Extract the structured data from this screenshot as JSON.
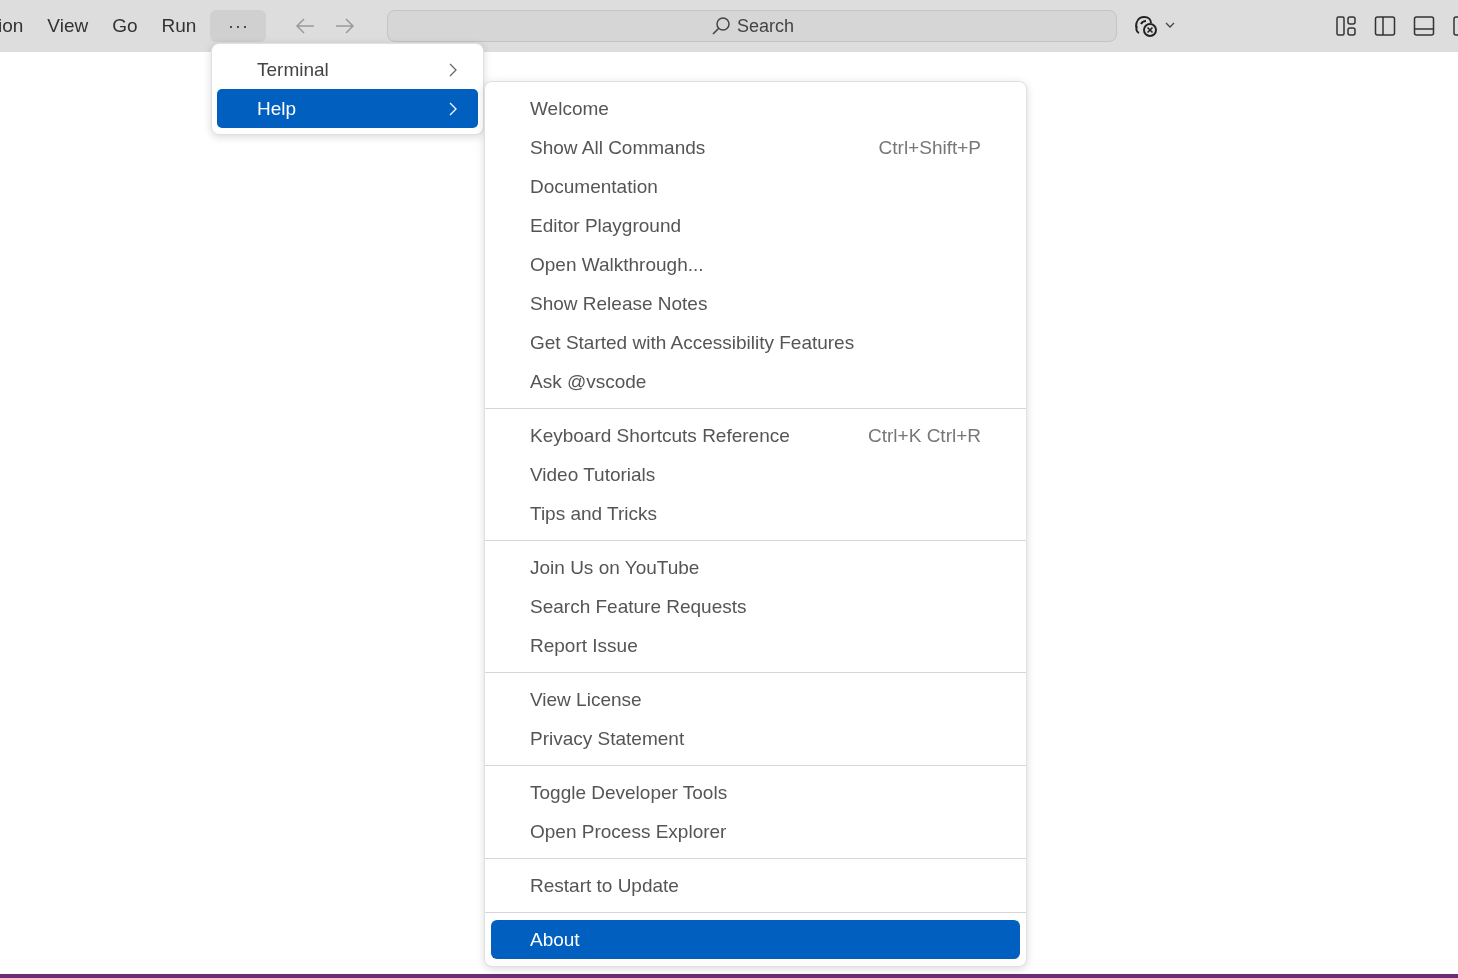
{
  "menubar": {
    "items": [
      {
        "label": "ion"
      },
      {
        "label": "View"
      },
      {
        "label": "Go"
      },
      {
        "label": "Run"
      }
    ],
    "more": {
      "label": "···",
      "selected": true
    }
  },
  "search": {
    "placeholder": "Search"
  },
  "more_menu": {
    "items": [
      {
        "label": "Terminal",
        "selected": false
      },
      {
        "label": "Help",
        "selected": true
      }
    ]
  },
  "help_menu": {
    "groups": [
      {
        "items": [
          {
            "label": "Welcome",
            "selected": false
          },
          {
            "label": "Show All Commands",
            "shortcut": "Ctrl+Shift+P",
            "selected": false
          },
          {
            "label": "Documentation",
            "selected": false
          },
          {
            "label": "Editor Playground",
            "selected": false
          },
          {
            "label": "Open Walkthrough...",
            "selected": false
          },
          {
            "label": "Show Release Notes",
            "selected": false
          },
          {
            "label": "Get Started with Accessibility Features",
            "selected": false
          },
          {
            "label": "Ask @vscode",
            "selected": false
          }
        ]
      },
      {
        "items": [
          {
            "label": "Keyboard Shortcuts Reference",
            "shortcut": "Ctrl+K Ctrl+R",
            "selected": false
          },
          {
            "label": "Video Tutorials",
            "selected": false
          },
          {
            "label": "Tips and Tricks",
            "selected": false
          }
        ]
      },
      {
        "items": [
          {
            "label": "Join Us on YouTube",
            "selected": false
          },
          {
            "label": "Search Feature Requests",
            "selected": false
          },
          {
            "label": "Report Issue",
            "selected": false
          }
        ]
      },
      {
        "items": [
          {
            "label": "View License",
            "selected": false
          },
          {
            "label": "Privacy Statement",
            "selected": false
          }
        ]
      },
      {
        "items": [
          {
            "label": "Toggle Developer Tools",
            "selected": false
          },
          {
            "label": "Open Process Explorer",
            "selected": false
          }
        ]
      },
      {
        "items": [
          {
            "label": "Restart to Update",
            "selected": false
          }
        ]
      },
      {
        "items": [
          {
            "label": "About",
            "selected": true
          }
        ]
      }
    ]
  }
}
